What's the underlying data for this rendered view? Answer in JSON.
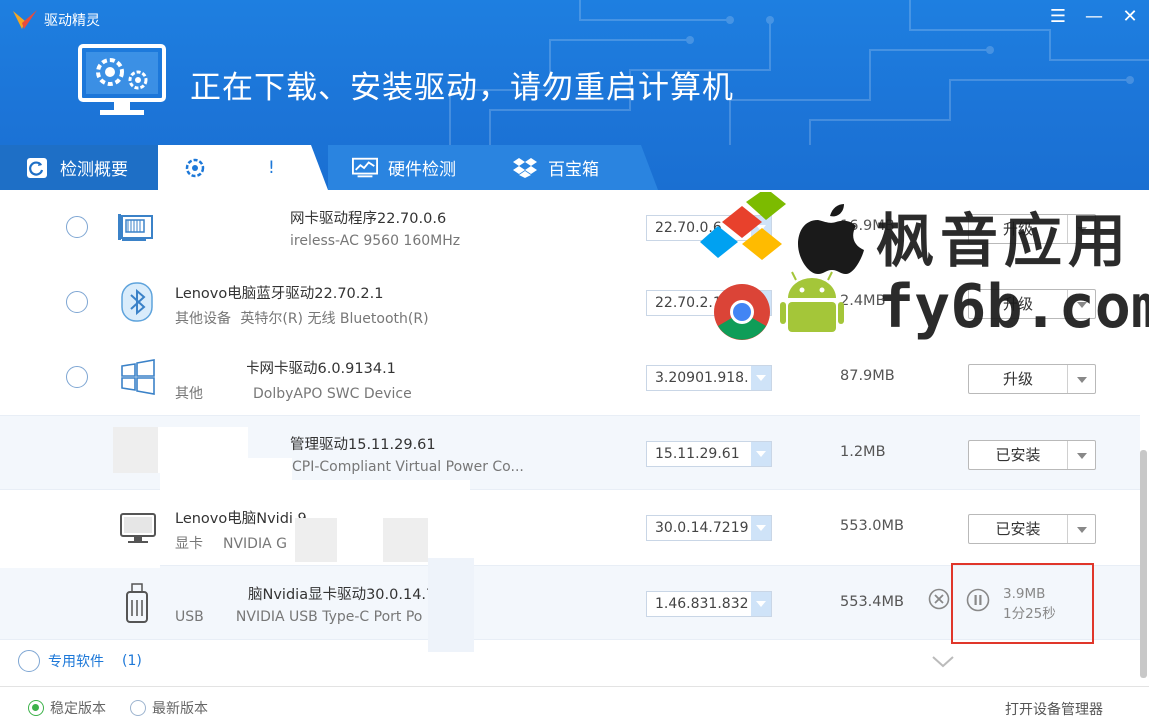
{
  "app": {
    "title": "驱动精灵",
    "menu_glyph": "☰",
    "minimize_glyph": "—",
    "close_glyph": "✕"
  },
  "banner": {
    "text": "正在下载、安装驱动，请勿重启计算机"
  },
  "tabs": [
    {
      "label": "检测概要",
      "icon": "refresh-icon"
    },
    {
      "label": "!",
      "icon": "gear-icon"
    },
    {
      "label": "硬件检测",
      "icon": "monitor-chart-icon"
    },
    {
      "label": "百宝箱",
      "icon": "dropbox-icon"
    }
  ],
  "drivers": [
    {
      "name": "网卡驱动程序22.70.0.6",
      "category": "",
      "device": "ireless-AC 9560 160MHz",
      "version": "22.70.0.6",
      "size": "16.9MB",
      "action": "升级",
      "icon": "network-card-icon"
    },
    {
      "name": "Lenovo电脑蓝牙驱动22.70.2.1",
      "category": "其他设备",
      "device": "英特尔(R) 无线 Bluetooth(R)",
      "version": "22.70.2.1",
      "size": "2.4MB",
      "action": "升级",
      "icon": "bluetooth-icon"
    },
    {
      "name": "卡网卡驱动6.0.9134.1",
      "category": "其他",
      "device": "DolbyAPO SWC Device",
      "version": "3.20901.918.",
      "size": "87.9MB",
      "action": "升级",
      "icon": "windows-icon"
    },
    {
      "name": "管理驱动15.11.29.61",
      "category": "",
      "device": "CPI-Compliant Virtual Power Co...",
      "version": "15.11.29.61",
      "size": "1.2MB",
      "action": "已安装",
      "icon": ""
    },
    {
      "name": "Lenovo电脑Nvidi 9",
      "category": "显卡",
      "device": "NVIDIA G",
      "version": "30.0.14.7219",
      "size": "553.0MB",
      "action": "已安装",
      "icon": "monitor-icon"
    },
    {
      "name": "脑Nvidia显卡驱动30.0.14.7155",
      "category": "USB",
      "device": "NVIDIA USB Type-C Port Po",
      "version": "1.46.831.832",
      "size": "553.4MB",
      "downloaded": "3.9MB",
      "remaining": "1分25秒",
      "icon": "usb-drive-icon"
    }
  ],
  "special_software": {
    "label": "专用软件",
    "count": "(1)"
  },
  "footer": {
    "stable": "稳定版本",
    "latest": "最新版本",
    "device_manager": "打开设备管理器"
  },
  "watermark": {
    "cn": "枫音应用",
    "en": "fy6b.com"
  },
  "colors": {
    "header": "#1e7fe0",
    "accent": "#1d78d8",
    "highlight": "#e0362a"
  }
}
